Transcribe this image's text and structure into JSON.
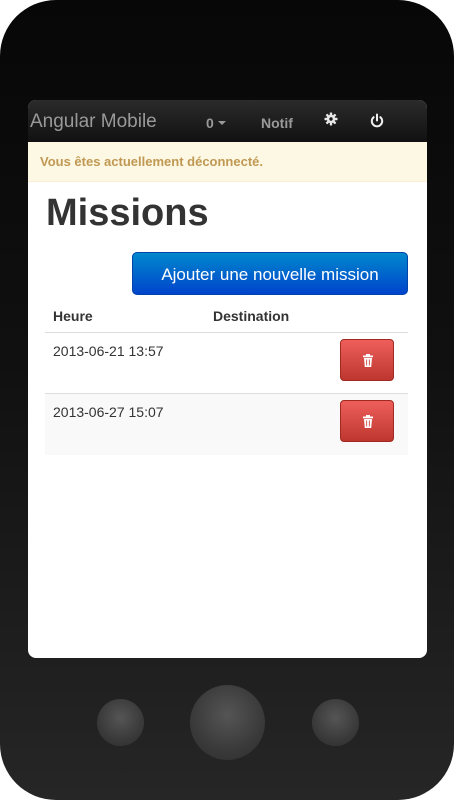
{
  "navbar": {
    "brand": "Angular Mobile",
    "count": "0",
    "notif": "Notif"
  },
  "alert": {
    "text": "Vous êtes actuellement déconnecté."
  },
  "page": {
    "title": "Missions",
    "add_button": "Ajouter une nouvelle mission"
  },
  "table": {
    "headers": [
      "Heure",
      "Destination"
    ],
    "rows": [
      {
        "heure": "2013-06-21 13:57",
        "destination": ""
      },
      {
        "heure": "2013-06-27 15:07",
        "destination": ""
      }
    ]
  },
  "icons": {
    "gear": "gear-icon",
    "power": "power-icon",
    "trash": "trash-icon",
    "caret": "chevron-down-icon"
  },
  "colors": {
    "primary": "#0074cc",
    "danger": "#da4f49",
    "warning_text": "#c09853",
    "warning_bg": "#fcf8e3"
  }
}
